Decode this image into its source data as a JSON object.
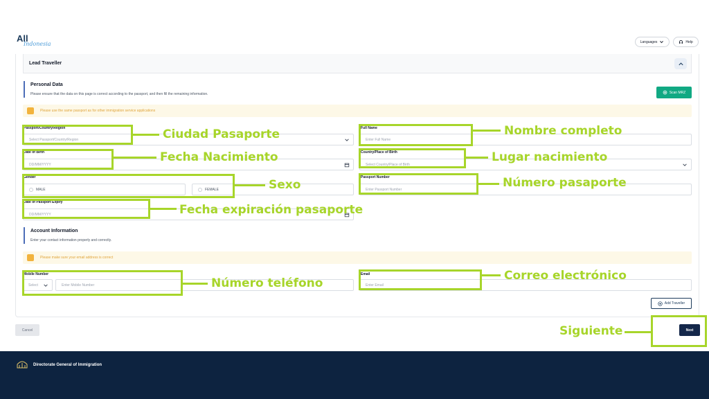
{
  "header": {
    "logo_main": "All",
    "logo_sub": "Indonesia",
    "languages_label": "Languages",
    "help_label": "Help"
  },
  "lead": {
    "title": "Lead Traveller"
  },
  "personal": {
    "title": "Personal Data",
    "subtitle": "Please ensure that the data on this page is correct according to the passport, and then fill the remaining information.",
    "scan_label": "Scan MRZ",
    "notice": "Please use the same passport as for other immigration service applications",
    "fields": {
      "passport_country": {
        "label": "Passport/Country/Region",
        "placeholder": "Select Passport/Country/Region"
      },
      "full_name": {
        "label": "Full Name",
        "placeholder": "Enter Full Name"
      },
      "dob": {
        "label": "Date of Birth",
        "placeholder": "DD/MM/YYYY"
      },
      "birth_place": {
        "label": "Country/Place of Birth",
        "placeholder": "Select Country/Place of Birth"
      },
      "gender": {
        "label": "Gender",
        "male": "MALE",
        "female": "FEMALE"
      },
      "passport_number": {
        "label": "Passport Number",
        "placeholder": "Enter Passport Number"
      },
      "passport_expiry": {
        "label": "Date of Passport Expiry",
        "placeholder": "DD/MM/YYYY"
      }
    }
  },
  "account": {
    "title": "Account Information",
    "subtitle": "Enter your contact information properly and correctly.",
    "notice": "Please make sure your email address is correct",
    "mobile": {
      "label": "Mobile Number",
      "select": "Select",
      "placeholder": "Enter Mobile Number"
    },
    "email": {
      "label": "Email",
      "placeholder": "Enter Email"
    },
    "add_traveller": "Add Traveller"
  },
  "actions": {
    "cancel": "Cancel",
    "next": "Next"
  },
  "annotations": {
    "ciudad": "Ciudad Pasaporte",
    "nombre": "Nombre completo",
    "fecha_nac": "Fecha Nacimiento",
    "lugar": "Lugar nacimiento",
    "sexo": "Sexo",
    "numero_pas": "Número pasaporte",
    "fecha_exp": "Fecha expiración pasaporte",
    "telefono": "Número teléfono",
    "correo": "Correo electrónico",
    "siguiente": "Siguiente"
  },
  "footer": {
    "text": "Directorate General of Immigration"
  },
  "colors": {
    "highlight": "#a7d52a",
    "primary": "#14274a",
    "accent": "#11a983",
    "notice_bg": "#fdf8e7"
  }
}
